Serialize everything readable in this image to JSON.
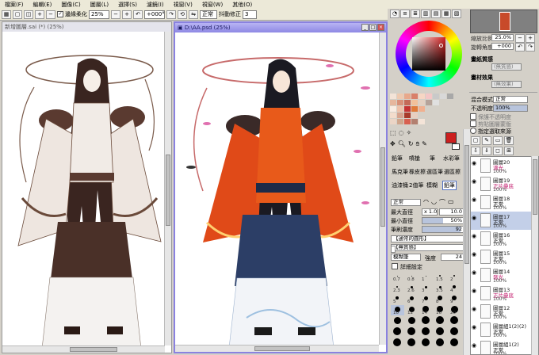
{
  "menu": [
    "檔案(F)",
    "編輯(E)",
    "圖像(C)",
    "圖層(L)",
    "選擇(S)",
    "濾鏡(I)",
    "視窗(V)",
    "視窗(W)",
    "其他(O)"
  ],
  "toolbar": {
    "antialias_label": "邊緣柔化",
    "zoom_value": "25%",
    "rotate_value": "+000°",
    "mode_value": "正常",
    "stabilizer_label": "抖動修正",
    "stabilizer_value": "3"
  },
  "windows": [
    {
      "title": "新增圖層.sai (*) (25%)",
      "active": false
    },
    {
      "title": "D:\\AA.psd (25%)",
      "active": true
    }
  ],
  "nav": {
    "zoom_label": "縮放比例",
    "zoom_value": "25.0%",
    "angle_label": "旋轉角度",
    "angle_value": "+000"
  },
  "layer_props": {
    "paper_texture_label": "畫紙質感",
    "paper_texture_value": "(無質感)",
    "paper_effect_label": "畫材效果",
    "paper_effect_value": "(無效果)",
    "blend_label": "混合模式",
    "blend_value": "正常",
    "opacity_label": "不透明度",
    "opacity_value": "100%",
    "preserve_label": "保護不透明度",
    "clip_label": "剪貼圖層蒙版",
    "select_source_label": "指定選取來源"
  },
  "tools": {
    "rows": [
      [
        "鉛筆",
        "噴槍",
        "筆",
        "水彩筆"
      ],
      [
        "馬克筆",
        "橡皮擦",
        "選區筆",
        "選區擦"
      ],
      [
        "油漆桶",
        "2值筆",
        "模糊",
        "鉛筆"
      ]
    ],
    "mode_value": "正常",
    "size_label": "最大直徑",
    "size_mult": "x 1.0",
    "size_value": "10.0",
    "min_size_label": "最小直徑",
    "min_size_value": "50%",
    "density_label": "筆刷濃度",
    "density_value": "92",
    "shape_value": "【通常的圓形】",
    "texture_value": "【無質感】",
    "mix_value": "模糊筆",
    "strength_label": "強度",
    "strength_value": "24",
    "detail_label": "詳細設定"
  },
  "brush_sizes": [
    [
      "0.7",
      "0.8",
      "1",
      "1.5",
      "2"
    ],
    [
      "2.3",
      "2.6",
      "3",
      "3.5",
      "4"
    ],
    [
      "5",
      "6",
      "7",
      "8",
      "9"
    ],
    [
      "10",
      "12",
      "14",
      "16",
      "20"
    ],
    [
      "25",
      "30",
      "35",
      "40",
      "50"
    ],
    [
      "60",
      "70",
      "80",
      "100",
      "120"
    ],
    [
      "160",
      "200",
      "250",
      "300",
      "350"
    ]
  ],
  "layers": [
    {
      "name": "圖層20",
      "mode": "濾光",
      "opacity": "100%",
      "pink": true
    },
    {
      "name": "圖層19",
      "mode": "正片疊底",
      "opacity": "100%",
      "pink": true
    },
    {
      "name": "圖層18",
      "mode": "正常",
      "opacity": "100%",
      "pink": false
    },
    {
      "name": "圖層17",
      "mode": "正常",
      "opacity": "100%",
      "pink": false
    },
    {
      "name": "圖層16",
      "mode": "正常",
      "opacity": "100%",
      "pink": false
    },
    {
      "name": "圖層15",
      "mode": "正常",
      "opacity": "100%",
      "pink": false
    },
    {
      "name": "圖層14",
      "mode": "發光",
      "opacity": "100%",
      "pink": true
    },
    {
      "name": "圖層13",
      "mode": "正片疊底",
      "opacity": "100%",
      "pink": true
    },
    {
      "name": "圖層12",
      "mode": "正常",
      "opacity": "100%",
      "pink": false
    },
    {
      "name": "圖層組1(2)(2)",
      "mode": "正常",
      "opacity": "100%",
      "pink": false
    },
    {
      "name": "圖層組1(2)",
      "mode": "正常",
      "opacity": "100%",
      "pink": false
    }
  ],
  "colors": {
    "main": "#cc1f1f",
    "accent_title": "#2c4a9e"
  }
}
